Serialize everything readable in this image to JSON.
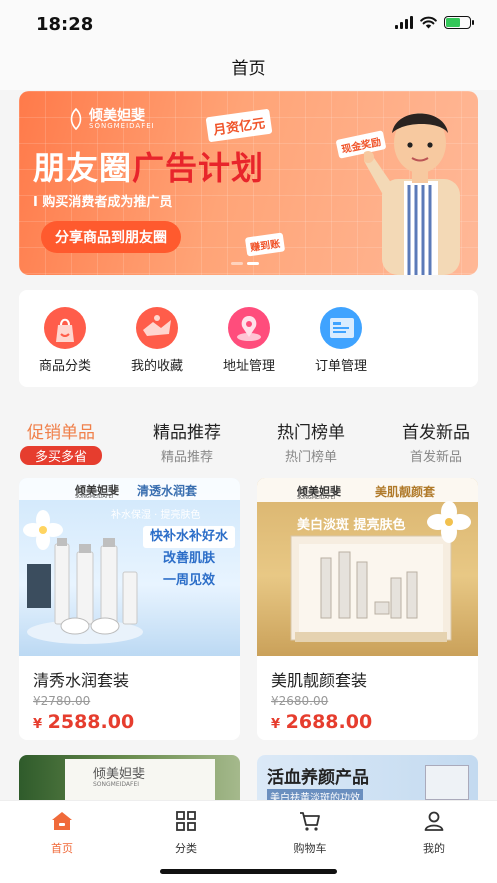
{
  "status_bar": {
    "time": "18:28"
  },
  "nav": {
    "title": "首页"
  },
  "banner": {
    "brand": "倾美妲斐",
    "brand_en": "SONGMEIDAFEI",
    "tag_top": "月资亿元",
    "title_a": "朋友圈",
    "title_b": "广告计划",
    "subtitle": "I 购买消费者成为推广员",
    "cta": "分享商品到朋友圈",
    "tag_cash": "现金奖励",
    "tag_earn": "赚到账",
    "slides": 2,
    "active_slide": 2,
    "colors": {
      "start": "#ff7a4a",
      "end": "#ffb897"
    }
  },
  "quick": {
    "items": [
      {
        "label": "商品分类",
        "icon": "shopping-bag-icon"
      },
      {
        "label": "我的收藏",
        "icon": "favorite-icon"
      },
      {
        "label": "地址管理",
        "icon": "map-pin-icon"
      },
      {
        "label": "订单管理",
        "icon": "order-list-icon"
      }
    ]
  },
  "tabs": [
    {
      "title": "促销单品",
      "sub": "多买多省"
    },
    {
      "title": "精品推荐",
      "sub": "精品推荐"
    },
    {
      "title": "热门榜单",
      "sub": "热门榜单"
    },
    {
      "title": "首发新品",
      "sub": "首发新品"
    }
  ],
  "products": [
    {
      "name": "清秀水润套装",
      "old_price": "¥2780.00",
      "price_sym": "¥",
      "price": "2588.00",
      "img": {
        "brand": "倾美妲斐",
        "brand_en": "SONGMEIDAFEI",
        "series": "清透水润套",
        "tagline": "补水保湿 · 提亮肤色",
        "slogan1": "快补水补好水",
        "slogan2": "改善肌肤",
        "slogan3": "一周见效"
      }
    },
    {
      "name": "美肌靓颜套装",
      "old_price": "¥2680.00",
      "price_sym": "¥",
      "price": "2688.00",
      "img": {
        "brand": "倾美妲斐",
        "brand_en": "SONGMEIDAFEI",
        "series": "美肌靓颜套",
        "tagline": "美白淡斑 提亮肤色"
      }
    },
    {
      "img": {
        "brand": "倾美妲斐",
        "brand_en": "SONGMEIDAFEI"
      }
    },
    {
      "img": {
        "title": "活血养颜产品",
        "subtitle": "美白祛黄淡斑的功效"
      }
    }
  ],
  "tabbar": {
    "items": [
      {
        "label": "首页",
        "icon": "home-icon"
      },
      {
        "label": "分类",
        "icon": "category-grid-icon"
      },
      {
        "label": "购物车",
        "icon": "cart-icon"
      },
      {
        "label": "我的",
        "icon": "profile-icon"
      }
    ],
    "active_color": "#f06a3a"
  },
  "accent": "#e63d2e"
}
